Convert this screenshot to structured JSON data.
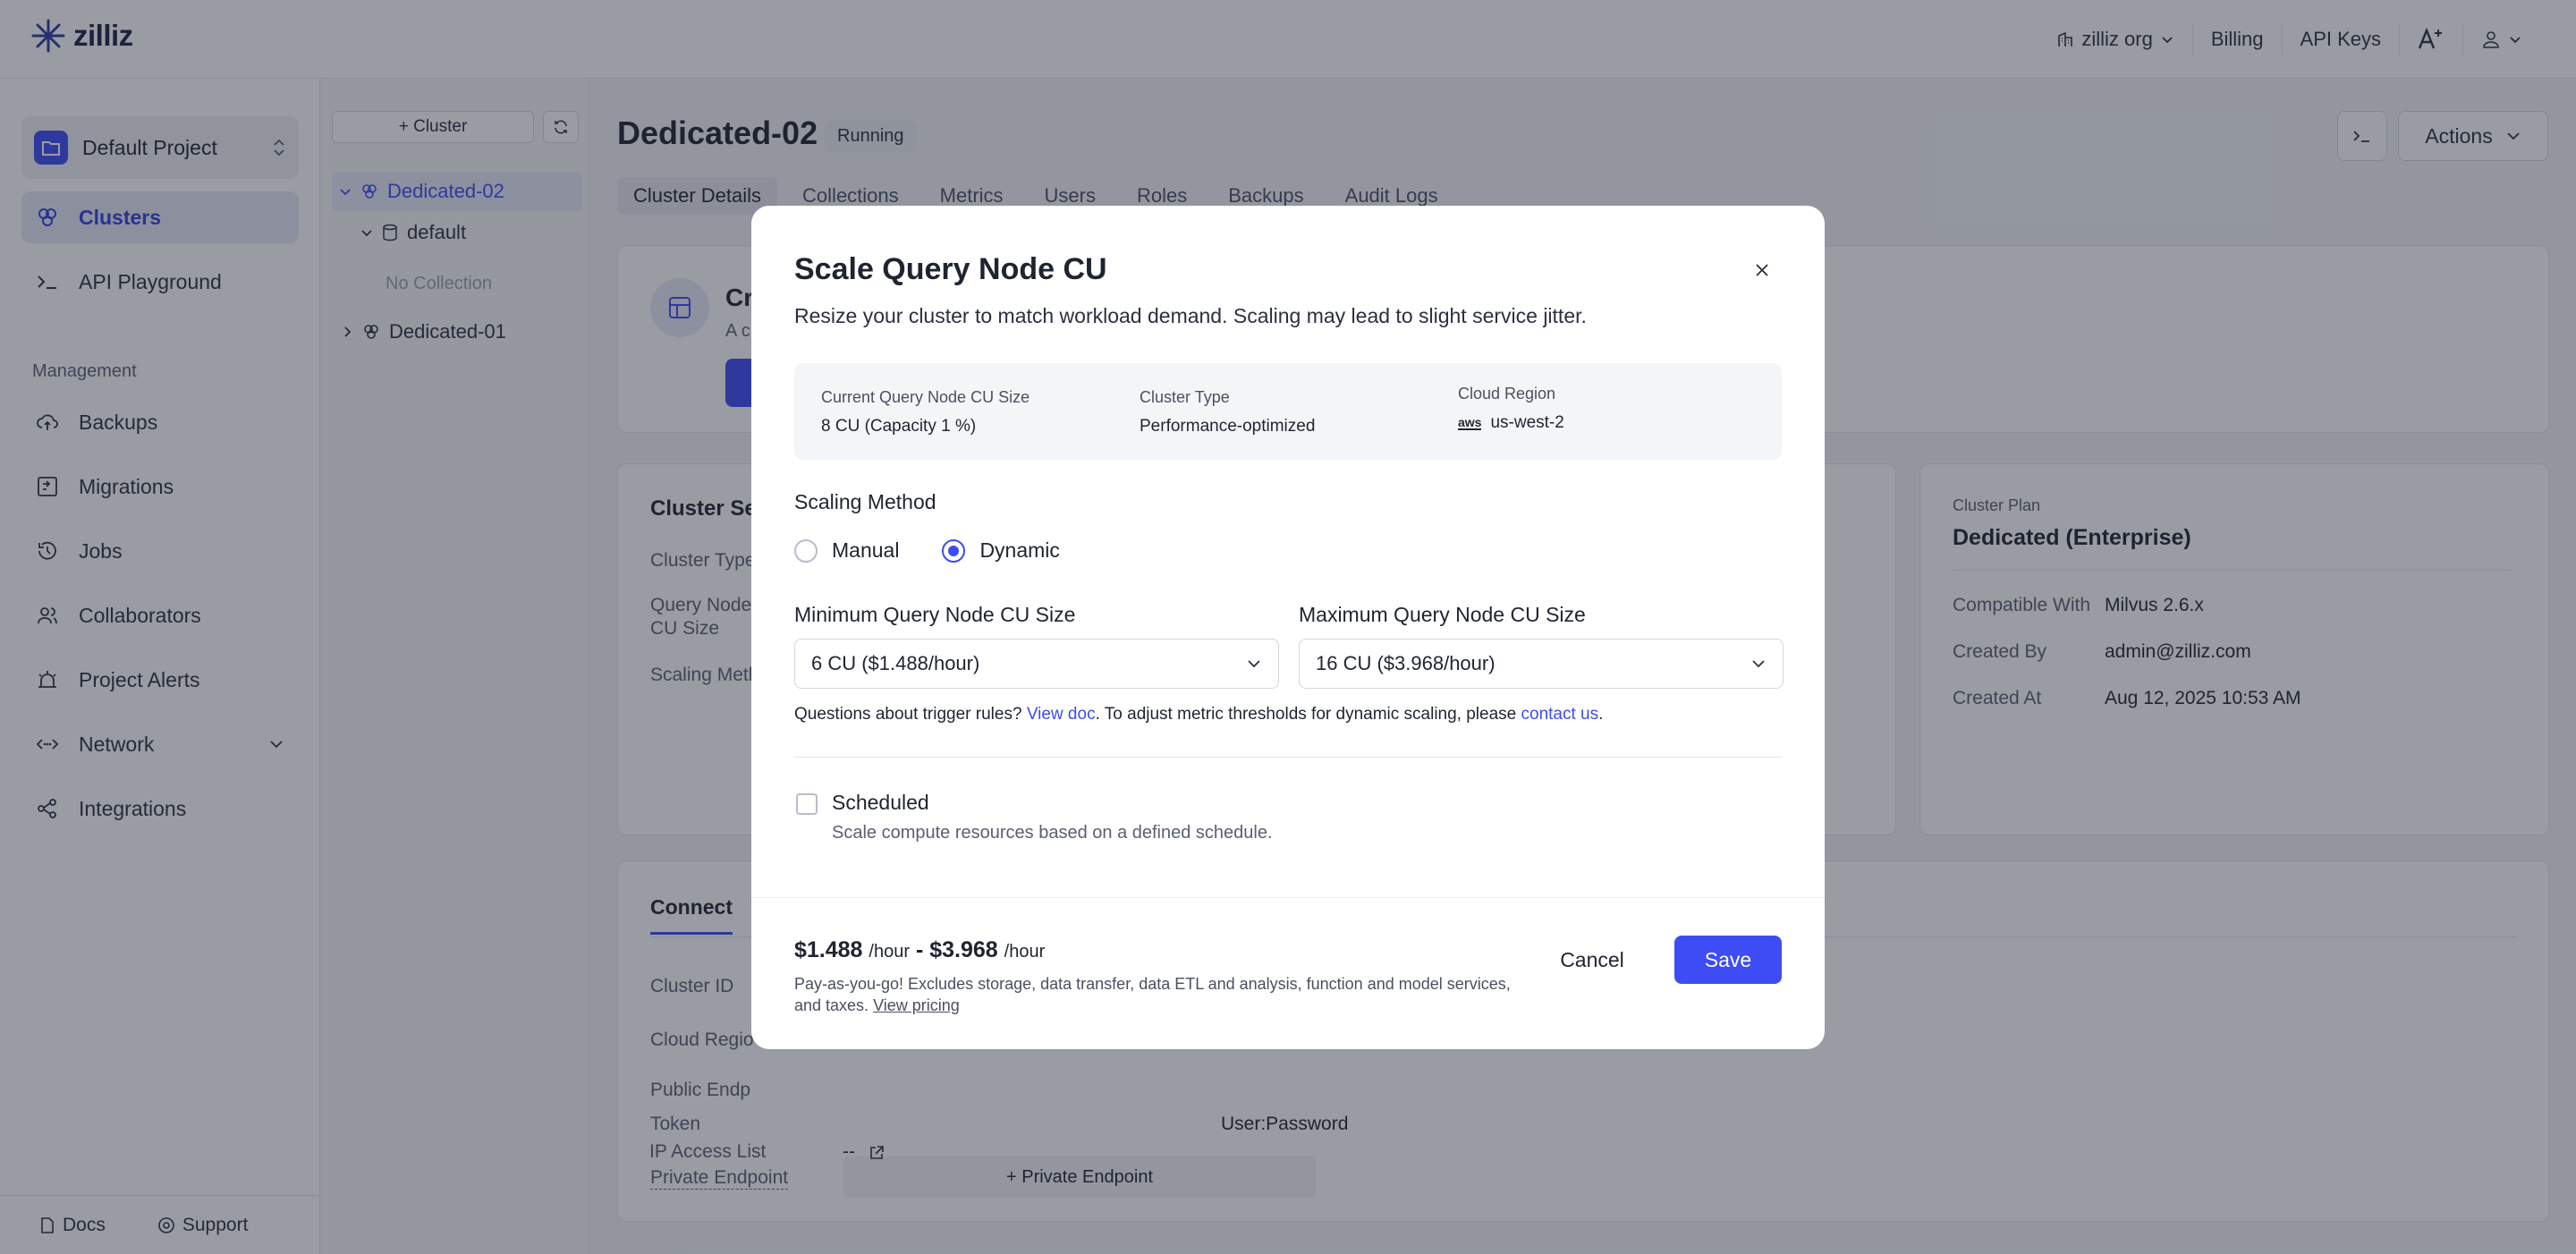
{
  "topbar": {
    "logo_text": "zilliz",
    "org_label": "zilliz org",
    "billing_label": "Billing",
    "api_keys_label": "API Keys"
  },
  "sidebar": {
    "project_name": "Default Project",
    "items": [
      {
        "label": "Clusters",
        "icon": "clusters-icon",
        "active": true
      },
      {
        "label": "API Playground",
        "icon": "terminal-icon"
      }
    ],
    "management_label": "Management",
    "management_items": [
      {
        "label": "Backups",
        "icon": "cloud-upload-icon"
      },
      {
        "label": "Migrations",
        "icon": "migrations-icon"
      },
      {
        "label": "Jobs",
        "icon": "history-icon"
      },
      {
        "label": "Collaborators",
        "icon": "users-icon"
      },
      {
        "label": "Project Alerts",
        "icon": "alarm-icon"
      },
      {
        "label": "Network",
        "icon": "network-icon"
      },
      {
        "label": "Integrations",
        "icon": "share-icon"
      }
    ],
    "docs_label": "Docs",
    "support_label": "Support"
  },
  "tree": {
    "add_cluster_label": "+ Cluster",
    "cluster_1": "Dedicated-02",
    "database": "default",
    "empty_label": "No Collection",
    "cluster_2": "Dedicated-01"
  },
  "main": {
    "title": "Dedicated-02",
    "status": "Running",
    "actions_label": "Actions",
    "tabs": [
      "Cluster Details",
      "Collections",
      "Metrics",
      "Users",
      "Roles",
      "Backups",
      "Audit Logs"
    ],
    "create_title": "Cr",
    "create_sub": "A c",
    "settings_title": "Cluster Set",
    "settings_keys": [
      "Cluster Type",
      "Query Node",
      "CU Size",
      "Scaling Meth"
    ],
    "plan": {
      "label": "Cluster Plan",
      "value": "Dedicated (Enterprise)",
      "rows": [
        {
          "k": "Compatible With",
          "v": "Milvus 2.6.x"
        },
        {
          "k": "Created By",
          "v": "admin@zilliz.com"
        },
        {
          "k": "Created At",
          "v": "Aug 12, 2025 10:53 AM"
        }
      ]
    },
    "connect": {
      "tab": "Connect",
      "rows": [
        "Cluster ID",
        "Cloud Regio",
        "Public Endp",
        "Token",
        "Private Endpoint",
        "IP Access List"
      ],
      "token_value": "User:Password",
      "private_endpoint_btn": "+ Private Endpoint",
      "ip_value": "--"
    }
  },
  "modal": {
    "title": "Scale Query Node CU",
    "subtitle": "Resize your cluster to match workload demand. Scaling may lead to slight service jitter.",
    "info": {
      "current_label": "Current Query Node CU Size",
      "current_value": "8 CU (Capacity 1 %)",
      "type_label": "Cluster Type",
      "type_value": "Performance-optimized",
      "region_label": "Cloud Region",
      "region_value": "us-west-2",
      "region_provider": "aws"
    },
    "scaling_label": "Scaling Method",
    "manual_label": "Manual",
    "dynamic_label": "Dynamic",
    "selected_method": "Dynamic",
    "min_label": "Minimum Query Node CU Size",
    "min_value": "6 CU ($1.488/hour)",
    "max_label": "Maximum Query Node CU Size",
    "max_value": "16 CU ($3.968/hour)",
    "help_pre": "Questions about trigger rules? ",
    "help_link1": "View doc",
    "help_mid": ". To adjust metric thresholds for dynamic scaling, please ",
    "help_link2": "contact us",
    "help_end": ".",
    "scheduled_label": "Scheduled",
    "scheduled_desc": "Scale compute resources based on a defined schedule.",
    "price_min": "$1.488",
    "price_max": "$3.968",
    "price_unit": "/hour",
    "price_sep": "-",
    "price_note": "Pay-as-you-go! Excludes storage, data transfer, data ETL and analysis, function and model services, and taxes.",
    "view_pricing": "View pricing",
    "cancel_label": "Cancel",
    "save_label": "Save"
  },
  "colors": {
    "accent": "#3d4cf5",
    "overlay": "#1e2434"
  }
}
